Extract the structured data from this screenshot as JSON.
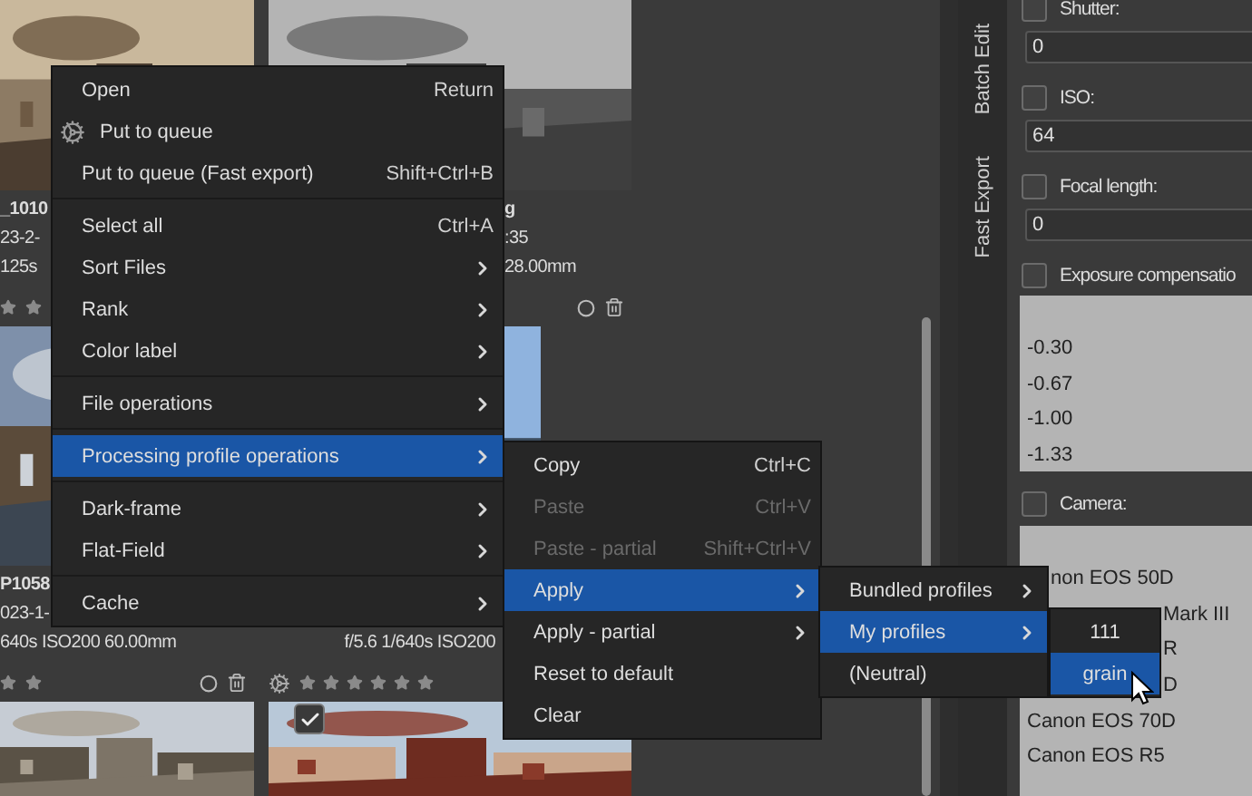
{
  "file_browser": {
    "rows": [
      {
        "cards": [
          {
            "kind": "file",
            "name": "_1010",
            "date": "23-2-",
            "exif": "125s",
            "in_queue": false,
            "actions": false
          },
          {
            "kind": "file",
            "name": "g",
            "date": ":35",
            "exif": "28.00mm",
            "in_queue": false,
            "actions": true
          }
        ]
      },
      {
        "cards": [
          {
            "kind": "file",
            "name": "P1058",
            "date": "023-1-",
            "exif": "640s ISO200 60.00mm",
            "in_queue": false,
            "actions": true
          },
          {
            "kind": "file",
            "exif": "f/5.6 1/640s ISO200",
            "stars": 0,
            "in_queue": true,
            "actions": false
          }
        ]
      },
      {
        "cards": [
          {
            "kind": "picture"
          },
          {
            "kind": "picture",
            "checked": true
          }
        ]
      }
    ]
  },
  "side_tabs": [
    {
      "label": "Batch Edit"
    },
    {
      "label": "Fast Export"
    }
  ],
  "panel": {
    "fields": [
      {
        "label": "Shutter:",
        "checked": false,
        "value": "0"
      },
      {
        "label": "ISO:",
        "checked": false,
        "value": "64"
      },
      {
        "label": "Focal length:",
        "checked": false,
        "value": "0"
      }
    ],
    "exposure": {
      "label": "Exposure compensatio",
      "checked": false,
      "options": [
        "-0.30",
        "-0.67",
        "-1.00",
        "-1.33"
      ]
    },
    "camera": {
      "label": "Camera:",
      "checked": false,
      "options": [
        {
          "kind": "after_short_menu",
          "text": "non EOS 50D"
        },
        {
          "kind": "after_long_menu",
          "text": "Mark III"
        },
        {
          "kind": "after_long_menu",
          "text": "R"
        },
        {
          "kind": "after_long_menu",
          "text": "D"
        },
        {
          "kind": "full",
          "text": "Canon EOS 70D"
        },
        {
          "kind": "full",
          "text": "Canon EOS R5"
        }
      ]
    }
  },
  "menus": [
    {
      "items": [
        {
          "kind": "action",
          "label": "Open",
          "shortcut": "Return",
          "selected": false
        },
        {
          "kind": "action_icon",
          "label": "Put to queue",
          "selected": false
        },
        {
          "kind": "action",
          "label": "Put to queue (Fast export)",
          "shortcut": "Shift+Ctrl+B",
          "selected": false
        },
        {
          "kind": "separator"
        },
        {
          "kind": "action",
          "label": "Select all",
          "shortcut": "Ctrl+A",
          "selected": false
        },
        {
          "kind": "submenu",
          "label": "Sort Files",
          "selected": false
        },
        {
          "kind": "submenu",
          "label": "Rank",
          "selected": false
        },
        {
          "kind": "submenu",
          "label": "Color label",
          "selected": false
        },
        {
          "kind": "separator"
        },
        {
          "kind": "submenu",
          "label": "File operations",
          "selected": false
        },
        {
          "kind": "separator"
        },
        {
          "kind": "submenu",
          "label": "Processing profile operations",
          "selected": true
        },
        {
          "kind": "separator"
        },
        {
          "kind": "submenu",
          "label": "Dark-frame",
          "selected": false
        },
        {
          "kind": "submenu",
          "label": "Flat-Field",
          "selected": false
        },
        {
          "kind": "separator"
        },
        {
          "kind": "submenu",
          "label": "Cache",
          "selected": false
        }
      ]
    },
    {
      "items": [
        {
          "kind": "action",
          "label": "Copy",
          "shortcut": "Ctrl+C",
          "selected": false,
          "disabled": false
        },
        {
          "kind": "action",
          "label": "Paste",
          "shortcut": "Ctrl+V",
          "selected": false,
          "disabled": true
        },
        {
          "kind": "action",
          "label": "Paste - partial",
          "shortcut": "Shift+Ctrl+V",
          "selected": false,
          "disabled": true
        },
        {
          "kind": "submenu",
          "label": "Apply",
          "selected": true,
          "disabled": false
        },
        {
          "kind": "submenu",
          "label": "Apply - partial",
          "selected": false,
          "disabled": false
        },
        {
          "kind": "action",
          "label": "Reset to default",
          "selected": false,
          "disabled": false
        },
        {
          "kind": "action",
          "label": "Clear",
          "selected": false,
          "disabled": false
        }
      ]
    },
    {
      "items": [
        {
          "kind": "submenu",
          "label": "Bundled profiles",
          "selected": false
        },
        {
          "kind": "submenu",
          "label": "My profiles",
          "selected": true
        },
        {
          "kind": "action",
          "label": "(Neutral)",
          "selected": false
        }
      ]
    },
    {
      "items": [
        {
          "kind": "profile",
          "label": "111",
          "selected": false
        },
        {
          "kind": "profile",
          "label": "grain",
          "selected": true
        }
      ]
    }
  ]
}
